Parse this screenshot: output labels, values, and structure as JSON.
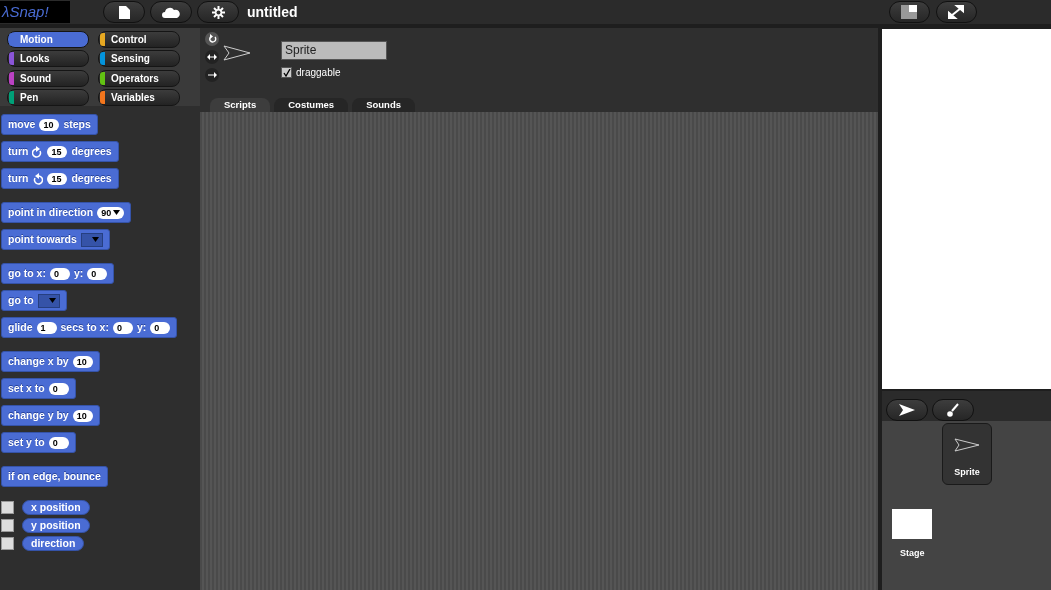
{
  "logo": "λSnap!",
  "project_title": "untitled",
  "categories": [
    {
      "name": "Motion",
      "color": "#4a6cd4",
      "selected": true
    },
    {
      "name": "Control",
      "color": "#e6a822",
      "selected": false
    },
    {
      "name": "Looks",
      "color": "#8a55d7",
      "selected": false
    },
    {
      "name": "Sensing",
      "color": "#0494dc",
      "selected": false
    },
    {
      "name": "Sound",
      "color": "#bb42c3",
      "selected": false
    },
    {
      "name": "Operators",
      "color": "#62c213",
      "selected": false
    },
    {
      "name": "Pen",
      "color": "#00a178",
      "selected": false
    },
    {
      "name": "Variables",
      "color": "#f3761d",
      "selected": false
    }
  ],
  "block_groups": [
    [
      {
        "parts": [
          {
            "kind": "label",
            "text": "move"
          },
          {
            "kind": "slot",
            "text": "10"
          },
          {
            "kind": "label",
            "text": "steps"
          }
        ]
      },
      {
        "parts": [
          {
            "kind": "label",
            "text": "turn"
          },
          {
            "kind": "clockwise"
          },
          {
            "kind": "slot",
            "text": "15"
          },
          {
            "kind": "label",
            "text": "degrees"
          }
        ]
      },
      {
        "parts": [
          {
            "kind": "label",
            "text": "turn"
          },
          {
            "kind": "counterclockwise"
          },
          {
            "kind": "slot",
            "text": "15"
          },
          {
            "kind": "label",
            "text": "degrees"
          }
        ]
      }
    ],
    [
      {
        "parts": [
          {
            "kind": "label",
            "text": "point in direction"
          },
          {
            "kind": "dropslot",
            "text": "90"
          }
        ]
      },
      {
        "parts": [
          {
            "kind": "label",
            "text": "point towards"
          },
          {
            "kind": "menu"
          }
        ]
      }
    ],
    [
      {
        "parts": [
          {
            "kind": "label",
            "text": "go to x:"
          },
          {
            "kind": "slot",
            "text": "0"
          },
          {
            "kind": "label",
            "text": "y:"
          },
          {
            "kind": "slot",
            "text": "0"
          }
        ]
      },
      {
        "parts": [
          {
            "kind": "label",
            "text": "go to"
          },
          {
            "kind": "menu"
          }
        ]
      },
      {
        "parts": [
          {
            "kind": "label",
            "text": "glide"
          },
          {
            "kind": "slot",
            "text": "1"
          },
          {
            "kind": "label",
            "text": "secs to x:"
          },
          {
            "kind": "slot",
            "text": "0"
          },
          {
            "kind": "label",
            "text": "y:"
          },
          {
            "kind": "slot",
            "text": "0"
          }
        ]
      }
    ],
    [
      {
        "parts": [
          {
            "kind": "label",
            "text": "change x by"
          },
          {
            "kind": "slot",
            "text": "10"
          }
        ]
      },
      {
        "parts": [
          {
            "kind": "label",
            "text": "set x to"
          },
          {
            "kind": "slot",
            "text": "0"
          }
        ]
      },
      {
        "parts": [
          {
            "kind": "label",
            "text": "change y by"
          },
          {
            "kind": "slot",
            "text": "10"
          }
        ]
      },
      {
        "parts": [
          {
            "kind": "label",
            "text": "set y to"
          },
          {
            "kind": "slot",
            "text": "0"
          }
        ]
      }
    ],
    [
      {
        "parts": [
          {
            "kind": "label",
            "text": "if on edge, bounce"
          }
        ]
      }
    ]
  ],
  "reporters": [
    {
      "label": "x position",
      "checked": false
    },
    {
      "label": "y position",
      "checked": false
    },
    {
      "label": "direction",
      "checked": false
    }
  ],
  "rotation_styles": [
    {
      "kind": "rotate",
      "selected": true
    },
    {
      "kind": "flip",
      "selected": false
    },
    {
      "kind": "none",
      "selected": false
    }
  ],
  "sprite_name": "Sprite",
  "draggable": {
    "label": "draggable",
    "checked": true
  },
  "tabs": [
    {
      "label": "Scripts",
      "selected": true
    },
    {
      "label": "Costumes",
      "selected": false
    },
    {
      "label": "Sounds",
      "selected": false
    }
  ],
  "corral": {
    "sprites": [
      {
        "name": "Sprite",
        "selected": true
      }
    ],
    "stage_label": "Stage"
  }
}
